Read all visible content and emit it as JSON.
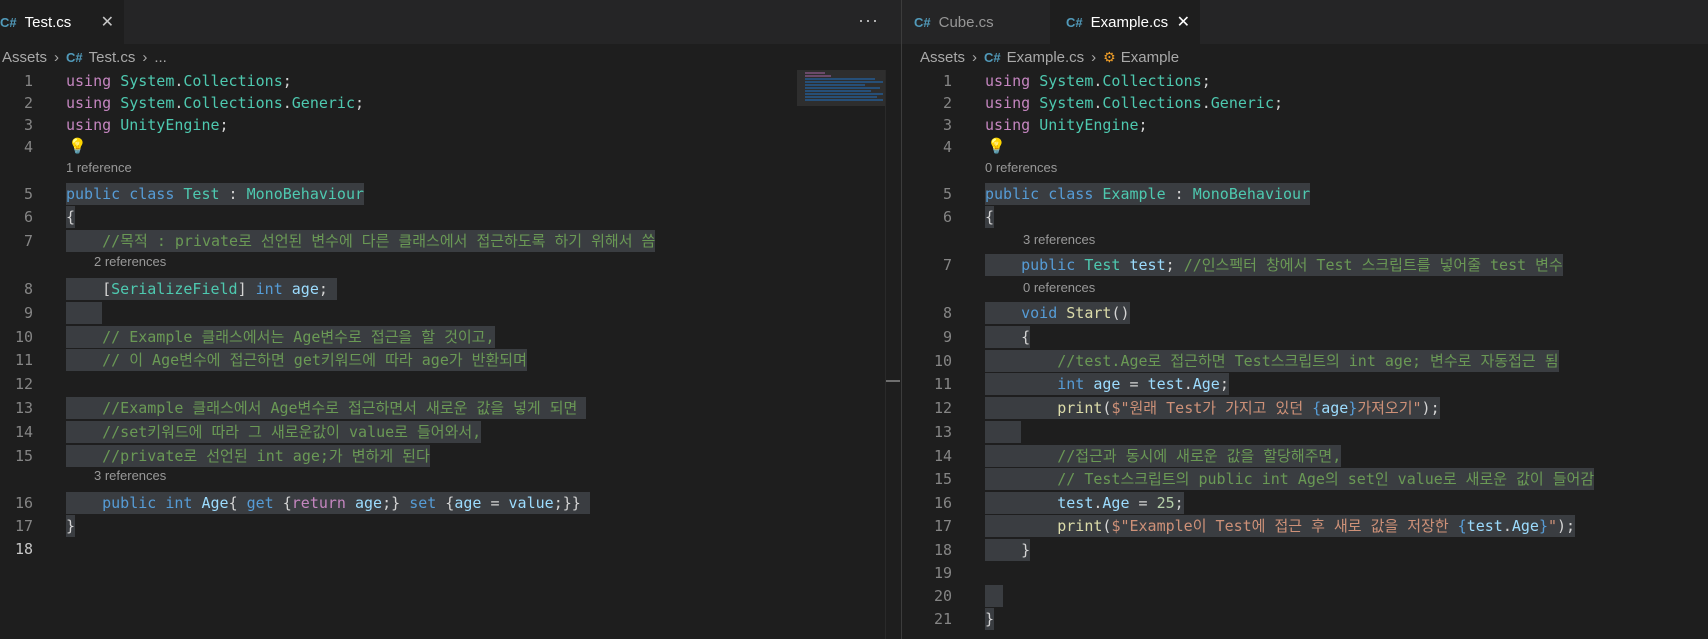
{
  "left": {
    "tab_label": "Test.cs",
    "more_label": "···",
    "breadcrumb": {
      "folder": "Assets",
      "file": "Test.cs",
      "tail": "..."
    },
    "codelens": [
      "1 reference",
      "2 references",
      "3 references"
    ],
    "lines": [
      [
        {
          "t": "using",
          "c": "kw2"
        },
        {
          "t": " ",
          "c": "pl"
        },
        {
          "t": "System",
          "c": "ns"
        },
        {
          "t": ".",
          "c": "pl"
        },
        {
          "t": "Collections",
          "c": "ns"
        },
        {
          "t": ";",
          "c": "pl"
        }
      ],
      [
        {
          "t": "using",
          "c": "kw2"
        },
        {
          "t": " ",
          "c": "pl"
        },
        {
          "t": "System",
          "c": "ns"
        },
        {
          "t": ".",
          "c": "pl"
        },
        {
          "t": "Collections",
          "c": "ns"
        },
        {
          "t": ".",
          "c": "pl"
        },
        {
          "t": "Generic",
          "c": "ns"
        },
        {
          "t": ";",
          "c": "pl"
        }
      ],
      [
        {
          "t": "using",
          "c": "kw2"
        },
        {
          "t": " ",
          "c": "pl"
        },
        {
          "t": "UnityEngine",
          "c": "ns"
        },
        {
          "t": ";",
          "c": "pl"
        }
      ],
      [],
      [
        {
          "t": "public",
          "c": "kw"
        },
        {
          "t": " ",
          "c": "pl"
        },
        {
          "t": "class",
          "c": "kw"
        },
        {
          "t": " ",
          "c": "pl"
        },
        {
          "t": "Test",
          "c": "ty"
        },
        {
          "t": " : ",
          "c": "pl"
        },
        {
          "t": "MonoBehaviour",
          "c": "ty"
        }
      ],
      [
        {
          "t": "{",
          "c": "pl"
        }
      ],
      [
        {
          "t": "    //목적 : private로 선언된 변수에 다른 클래스에서 접근하도록 하기 위해서 씀",
          "c": "cm"
        }
      ],
      [
        {
          "t": "    ",
          "c": "pl"
        },
        {
          "t": "[",
          "c": "pl"
        },
        {
          "t": "SerializeField",
          "c": "ty"
        },
        {
          "t": "] ",
          "c": "pl"
        },
        {
          "t": "int",
          "c": "kw"
        },
        {
          "t": " ",
          "c": "pl"
        },
        {
          "t": "age",
          "c": "var"
        },
        {
          "t": "; ",
          "c": "pl"
        }
      ],
      [
        {
          "t": "    ",
          "c": "pl"
        }
      ],
      [
        {
          "t": "    // Example 클래스에서는 Age변수로 접근을 할 것이고,",
          "c": "cm"
        }
      ],
      [
        {
          "t": "    // 이 Age변수에 접근하면 get키워드에 따라 age가 반환되며",
          "c": "cm"
        }
      ],
      [],
      [
        {
          "t": "    //Example 클래스에서 Age변수로 접근하면서 새로운 값을 넣게 되면 ",
          "c": "cm"
        }
      ],
      [
        {
          "t": "    //set키워드에 따라 그 새로운값이 value로 들어와서,",
          "c": "cm"
        }
      ],
      [
        {
          "t": "    //private로 선언된 int age;가 변하게 된다",
          "c": "cm"
        }
      ],
      [
        {
          "t": "    ",
          "c": "pl"
        },
        {
          "t": "public",
          "c": "kw"
        },
        {
          "t": " ",
          "c": "pl"
        },
        {
          "t": "int",
          "c": "kw"
        },
        {
          "t": " ",
          "c": "pl"
        },
        {
          "t": "Age",
          "c": "var"
        },
        {
          "t": "{ ",
          "c": "pl"
        },
        {
          "t": "get",
          "c": "kw"
        },
        {
          "t": " {",
          "c": "pl"
        },
        {
          "t": "return",
          "c": "kw2"
        },
        {
          "t": " ",
          "c": "pl"
        },
        {
          "t": "age",
          "c": "var"
        },
        {
          "t": ";} ",
          "c": "pl"
        },
        {
          "t": "set",
          "c": "kw"
        },
        {
          "t": " {",
          "c": "pl"
        },
        {
          "t": "age",
          "c": "var"
        },
        {
          "t": " = ",
          "c": "pl"
        },
        {
          "t": "value",
          "c": "var"
        },
        {
          "t": ";}} ",
          "c": "pl"
        }
      ],
      [
        {
          "t": "}",
          "c": "pl"
        }
      ],
      []
    ]
  },
  "right": {
    "tabs": [
      "Cube.cs",
      "Example.cs"
    ],
    "breadcrumb": {
      "folder": "Assets",
      "file": "Example.cs",
      "symbol": "Example"
    },
    "codelens": [
      "0 references",
      "3 references",
      "0 references"
    ],
    "lines": [
      [
        {
          "t": "using",
          "c": "kw2"
        },
        {
          "t": " ",
          "c": "pl"
        },
        {
          "t": "System",
          "c": "ns"
        },
        {
          "t": ".",
          "c": "pl"
        },
        {
          "t": "Collections",
          "c": "ns"
        },
        {
          "t": ";",
          "c": "pl"
        }
      ],
      [
        {
          "t": "using",
          "c": "kw2"
        },
        {
          "t": " ",
          "c": "pl"
        },
        {
          "t": "System",
          "c": "ns"
        },
        {
          "t": ".",
          "c": "pl"
        },
        {
          "t": "Collections",
          "c": "ns"
        },
        {
          "t": ".",
          "c": "pl"
        },
        {
          "t": "Generic",
          "c": "ns"
        },
        {
          "t": ";",
          "c": "pl"
        }
      ],
      [
        {
          "t": "using",
          "c": "kw2"
        },
        {
          "t": " ",
          "c": "pl"
        },
        {
          "t": "UnityEngine",
          "c": "ns"
        },
        {
          "t": ";",
          "c": "pl"
        }
      ],
      [],
      [
        {
          "t": "public",
          "c": "kw"
        },
        {
          "t": " ",
          "c": "pl"
        },
        {
          "t": "class",
          "c": "kw"
        },
        {
          "t": " ",
          "c": "pl"
        },
        {
          "t": "Example",
          "c": "ty"
        },
        {
          "t": " : ",
          "c": "pl"
        },
        {
          "t": "MonoBehaviour",
          "c": "ty"
        }
      ],
      [
        {
          "t": "{",
          "c": "pl"
        }
      ],
      [
        {
          "t": "    ",
          "c": "pl"
        },
        {
          "t": "public",
          "c": "kw"
        },
        {
          "t": " ",
          "c": "pl"
        },
        {
          "t": "Test",
          "c": "ty"
        },
        {
          "t": " ",
          "c": "pl"
        },
        {
          "t": "test",
          "c": "var"
        },
        {
          "t": "; ",
          "c": "pl"
        },
        {
          "t": "//인스펙터 창에서 Test 스크립트를 넣어줄 test 변수",
          "c": "cm"
        }
      ],
      [
        {
          "t": "    ",
          "c": "pl"
        },
        {
          "t": "void",
          "c": "kw"
        },
        {
          "t": " ",
          "c": "pl"
        },
        {
          "t": "Start",
          "c": "fn"
        },
        {
          "t": "()",
          "c": "pl"
        }
      ],
      [
        {
          "t": "    {",
          "c": "pl"
        }
      ],
      [
        {
          "t": "        //test.Age로 접근하면 Test스크립트의 int age; 변수로 자동접근 됨",
          "c": "cm"
        }
      ],
      [
        {
          "t": "        ",
          "c": "pl"
        },
        {
          "t": "int",
          "c": "kw"
        },
        {
          "t": " ",
          "c": "pl"
        },
        {
          "t": "age",
          "c": "var"
        },
        {
          "t": " = ",
          "c": "pl"
        },
        {
          "t": "test",
          "c": "var"
        },
        {
          "t": ".",
          "c": "pl"
        },
        {
          "t": "Age",
          "c": "var"
        },
        {
          "t": ";",
          "c": "pl"
        }
      ],
      [
        {
          "t": "        ",
          "c": "pl"
        },
        {
          "t": "print",
          "c": "fn"
        },
        {
          "t": "(",
          "c": "pl"
        },
        {
          "t": "$\"원래 Test가 가지고 있던 ",
          "c": "st"
        },
        {
          "t": "{",
          "c": "kw"
        },
        {
          "t": "age",
          "c": "var"
        },
        {
          "t": "}",
          "c": "kw"
        },
        {
          "t": "가져오기\"",
          "c": "st"
        },
        {
          "t": ");",
          "c": "pl"
        }
      ],
      [
        {
          "t": "    ",
          "c": "pl"
        }
      ],
      [
        {
          "t": "        //접근과 동시에 새로운 값을 할당해주면,",
          "c": "cm"
        }
      ],
      [
        {
          "t": "        // Test스크립트의 public int Age의 set인 value로 새로운 값이 들어감",
          "c": "cm"
        }
      ],
      [
        {
          "t": "        ",
          "c": "pl"
        },
        {
          "t": "test",
          "c": "var"
        },
        {
          "t": ".",
          "c": "pl"
        },
        {
          "t": "Age",
          "c": "var"
        },
        {
          "t": " = ",
          "c": "pl"
        },
        {
          "t": "25",
          "c": "nm"
        },
        {
          "t": ";",
          "c": "pl"
        }
      ],
      [
        {
          "t": "        ",
          "c": "pl"
        },
        {
          "t": "print",
          "c": "fn"
        },
        {
          "t": "(",
          "c": "pl"
        },
        {
          "t": "$\"Example이 Test에 접근 후 새로 값을 저장한 ",
          "c": "st"
        },
        {
          "t": "{",
          "c": "kw"
        },
        {
          "t": "test",
          "c": "var"
        },
        {
          "t": ".",
          "c": "pl"
        },
        {
          "t": "Age",
          "c": "var"
        },
        {
          "t": "}",
          "c": "kw"
        },
        {
          "t": "\"",
          "c": "st"
        },
        {
          "t": ");",
          "c": "pl"
        }
      ],
      [
        {
          "t": "    }",
          "c": "pl"
        }
      ],
      [],
      [
        {
          "t": "  ",
          "c": "pl"
        }
      ],
      [
        {
          "t": "}",
          "c": "pl"
        }
      ]
    ]
  }
}
